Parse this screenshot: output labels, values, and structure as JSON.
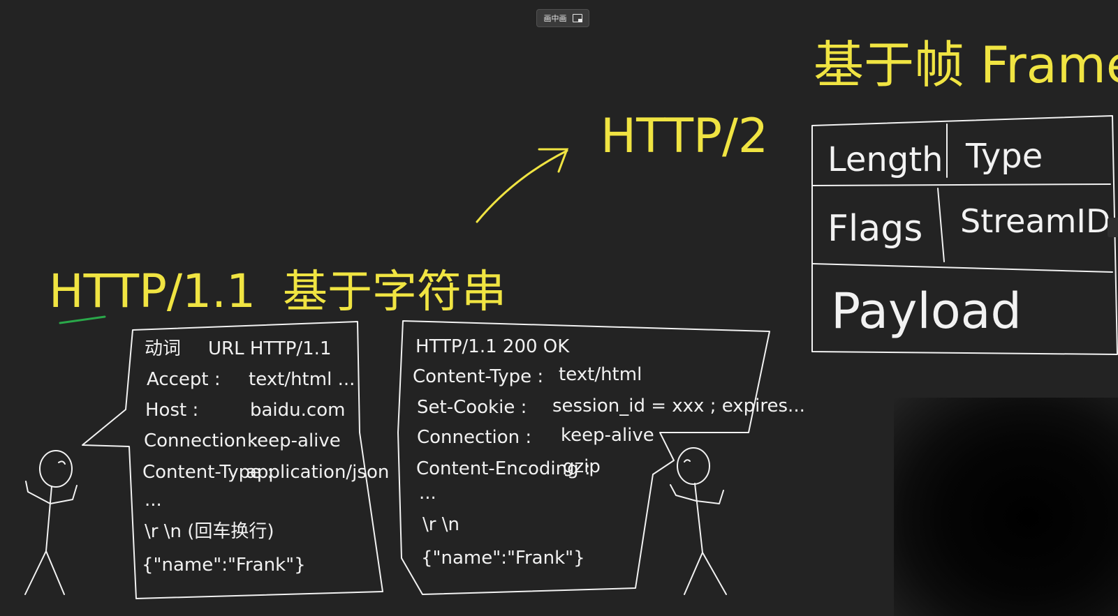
{
  "toolbar": {
    "pip_label": "画中画"
  },
  "colors": {
    "background": "#232323",
    "chalk": "#f2f2f2",
    "highlight": "#f0e442",
    "underline": "#2aa84a"
  },
  "headings": {
    "http11": "HTTP/1.1",
    "string_based": "基于字符串",
    "http2": "HTTP/2",
    "frame_based": "基于帧 Frame"
  },
  "request": {
    "lines": [
      {
        "key": "动词",
        "value": "URL      HTTP/1.1"
      },
      {
        "key": "Accept :",
        "value": "text/html ..."
      },
      {
        "key": "Host :",
        "value": "baidu.com"
      },
      {
        "key": "Connection :",
        "value": "keep-alive"
      },
      {
        "key": "Content-Type :",
        "value": "application/json"
      },
      {
        "key": "...",
        "value": ""
      },
      {
        "key": "\\r \\n (回车换行)",
        "value": ""
      },
      {
        "key": "{\"name\":\"Frank\"}",
        "value": ""
      }
    ]
  },
  "response": {
    "lines": [
      {
        "key": "HTTP/1.1    200    OK",
        "value": ""
      },
      {
        "key": "Content-Type :",
        "value": "text/html"
      },
      {
        "key": "Set-Cookie :",
        "value": "session_id = xxx ; expires..."
      },
      {
        "key": "Connection :",
        "value": "keep-alive"
      },
      {
        "key": "Content-Encoding :",
        "value": "gzip"
      },
      {
        "key": "...",
        "value": ""
      },
      {
        "key": "\\r \\n",
        "value": ""
      },
      {
        "key": "{\"name\":\"Frank\"}",
        "value": ""
      }
    ]
  },
  "frame": {
    "length": "Length",
    "type": "Type",
    "flags": "Flags",
    "stream_id": "StreamID",
    "payload": "Payload"
  }
}
